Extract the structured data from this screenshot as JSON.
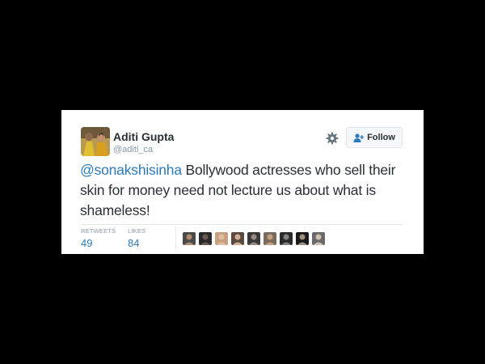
{
  "tweet": {
    "author_name": "Aditi Gupta",
    "author_handle": "@aditi_ca",
    "follow_label": "Follow",
    "mention": "@sonakshisinha",
    "text_rest": " Bollywood actresses who sell their skin for money need not lecture us about what is shameless!",
    "stats": {
      "retweets_label": "RETWEETS",
      "retweets_count": "49",
      "likes_label": "LIKES",
      "likes_count": "84"
    },
    "liker_count": 9
  },
  "colors": {
    "background": "#000000",
    "card": "#ffffff",
    "link_blue": "#2b7bb9",
    "text_dark": "#292f33",
    "text_gray": "#8899a6"
  },
  "icons": [
    "gear-icon",
    "add-user-icon"
  ]
}
